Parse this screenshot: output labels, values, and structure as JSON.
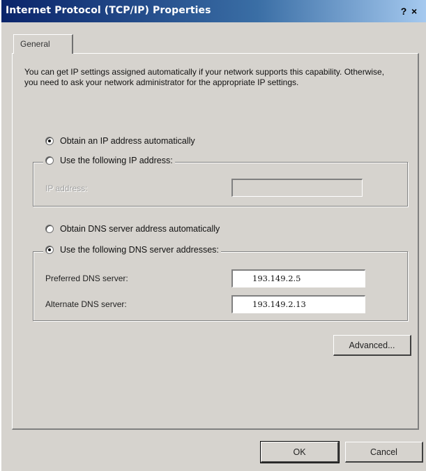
{
  "window": {
    "title": "Internet Protocol (TCP/IP) Properties",
    "help_glyph": "?",
    "close_glyph": "×"
  },
  "tabs": [
    {
      "label": "General",
      "active": true
    }
  ],
  "general": {
    "description": "You can get IP settings assigned automatically if your network supports this capability. Otherwise, you need to ask your network administrator for the appropriate IP settings.",
    "ip": {
      "obtain_auto_label": "Obtain an IP address automatically",
      "obtain_auto_checked": true,
      "use_following_label": "Use the following IP address:",
      "use_following_checked": false,
      "ip_address_label": "IP address:",
      "ip_address_value": ""
    },
    "dns": {
      "obtain_auto_label": "Obtain DNS server address automatically",
      "obtain_auto_checked": false,
      "use_following_label": "Use the following DNS server addresses:",
      "use_following_checked": true,
      "preferred_label": "Preferred DNS server:",
      "preferred_value": "193.149.2.5",
      "alternate_label": "Alternate DNS server:",
      "alternate_value": "193.149.2.13"
    },
    "advanced_label": "Advanced..."
  },
  "footer": {
    "ok_label": "OK",
    "cancel_label": "Cancel"
  },
  "colors": {
    "title_gradient_start": "#0a246a",
    "title_gradient_end": "#a6caf0",
    "dialog_face": "#d6d3ce"
  }
}
